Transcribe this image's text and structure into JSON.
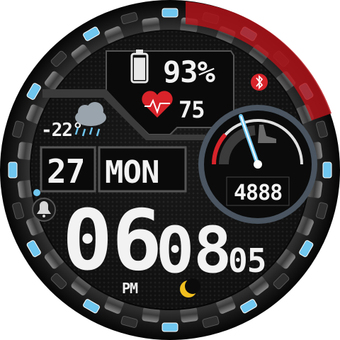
{
  "watch": {
    "battery": {
      "percent_label": "93%",
      "level": 0.93
    },
    "heart_rate": {
      "value": "75",
      "icon": "heart-pulse-icon"
    },
    "weather": {
      "temperature": "-22°",
      "icon": "rain-cloud-icon"
    },
    "date": {
      "day": "27",
      "weekday": "MON"
    },
    "time": {
      "hours": "06",
      "separator": ":",
      "minutes": "08",
      "seconds": "05",
      "ampm": "PM"
    },
    "steps": {
      "value": "4888",
      "icon": "shoe-icon"
    },
    "icons": {
      "bluetooth": "bluetooth-icon",
      "alarm": "alarm-bell-icon",
      "moon": "moon-icon"
    },
    "colors": {
      "accent_blue": "#6fc6ef",
      "accent_red": "#d8232a",
      "bezel": "#1a1a1a",
      "face": "#0b0b0b"
    }
  }
}
